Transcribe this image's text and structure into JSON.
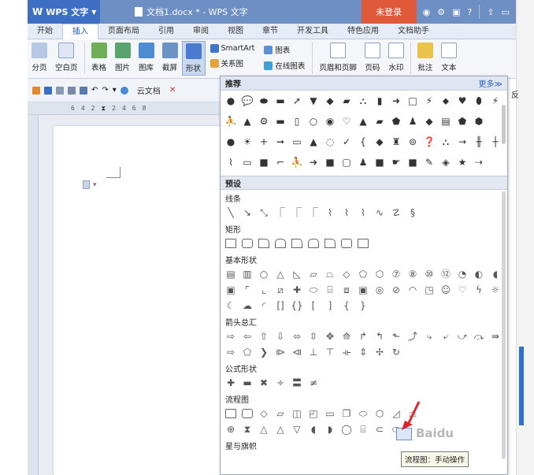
{
  "titlebar": {
    "app_label": "WPS 文字",
    "doc_title": "文档1.docx * - WPS 文字",
    "login_label": "未登录"
  },
  "tabs": [
    "开始",
    "插入",
    "页面布局",
    "引用",
    "审阅",
    "视图",
    "章节",
    "开发工具",
    "特色应用",
    "文档助手"
  ],
  "ribbon": {
    "page_break": "分页",
    "blank_page": "空白页",
    "table": "表格",
    "picture": "图片",
    "gallery": "图库",
    "screenshot": "截屏",
    "shapes": "形状",
    "smartart": "SmartArt",
    "chart": "图表",
    "relation_chart": "关系图",
    "online_chart": "在线图表",
    "header_footer": "页眉和页脚",
    "page_number": "页码",
    "watermark": "水印",
    "comment": "批注",
    "textbox": "文本"
  },
  "quickbar": {
    "cloud_doc": "云文档"
  },
  "ruler_ticks": [
    "6",
    "4",
    "2",
    "",
    "2",
    "4",
    "6",
    "8"
  ],
  "panel": {
    "recommended": "推荐",
    "more": "更多≫",
    "preset": "预设",
    "sections": {
      "lines": "线条",
      "rectangles": "矩形",
      "basic": "基本形状",
      "arrows": "箭头总汇",
      "equation": "公式形状",
      "flowchart": "流程图",
      "stars": "星与旗帜"
    }
  },
  "tooltip": "流程图：手动操作",
  "watermark_text": "Baidu",
  "right_edge_char": "反",
  "colors": {
    "titlebar": "#6d8fc3",
    "accent": "#2f6fd1",
    "login": "#e05a3a",
    "arrow": "#d9262c"
  }
}
